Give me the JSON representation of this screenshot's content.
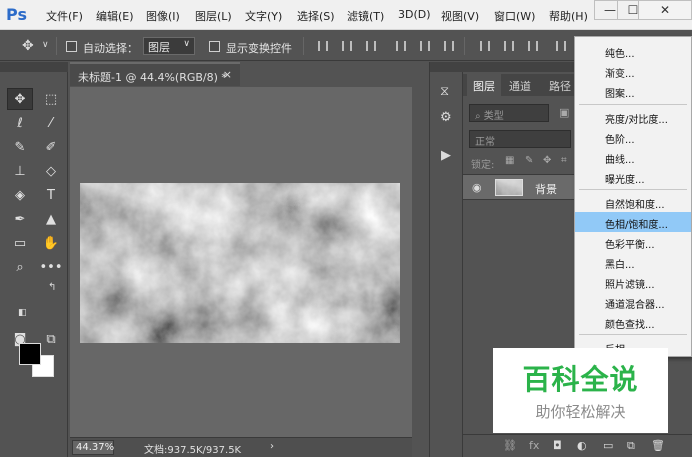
{
  "app": {
    "logo": "Ps"
  },
  "menu": {
    "items": [
      "文件(F)",
      "编辑(E)",
      "图像(I)",
      "图层(L)",
      "文字(Y)",
      "选择(S)",
      "滤镜(T)",
      "3D(D)",
      "视图(V)",
      "窗口(W)",
      "帮助(H)"
    ]
  },
  "window_controls": {
    "minimize": "—",
    "maximize": "☐",
    "close": "✕"
  },
  "options": {
    "auto_select_label": "自动选择：",
    "auto_select_value": "图层",
    "show_transform_label": "显示变换控件"
  },
  "document": {
    "tab_title": "未标题-1 @ 44.4%(RGB/8) *",
    "close": "×",
    "zoom": "44.37%",
    "doc_info": "文档:937.5K/937.5K",
    "arrow": "›"
  },
  "layers_panel": {
    "tabs": [
      "图层",
      "通道",
      "路径"
    ],
    "filter_placeholder": "类型",
    "blend_mode": "正常",
    "lock_label": "锁定:",
    "layer_name": "背景"
  },
  "adjustment_menu": {
    "items": [
      "纯色...",
      "渐变...",
      "图案...",
      "亮度/对比度...",
      "色阶...",
      "曲线...",
      "曝光度...",
      "自然饱和度...",
      "色相/饱和度...",
      "色彩平衡...",
      "黑白...",
      "照片滤镜...",
      "通道混合器...",
      "颜色查找...",
      "反相"
    ],
    "highlighted": "色相/饱和度..."
  },
  "watermark": {
    "title": "百科全说",
    "subtitle": "助你轻松解决"
  }
}
